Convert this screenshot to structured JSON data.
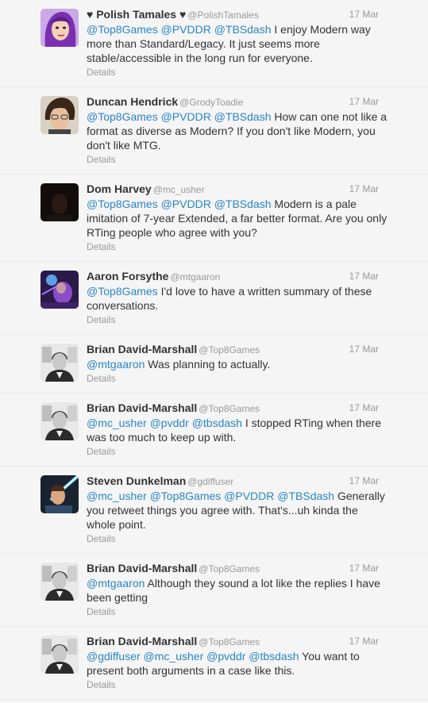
{
  "tweets": [
    {
      "name": "♥ Polish Tamales ♥",
      "handle": "@PolishTamales",
      "time": "17 Mar",
      "avatar": "purple-hair-avatar",
      "segments": [
        {
          "t": "@Top8Games",
          "m": true
        },
        {
          "t": " "
        },
        {
          "t": "@PVDDR",
          "m": true
        },
        {
          "t": " "
        },
        {
          "t": "@TBSdash",
          "m": true
        },
        {
          "t": " I enjoy Modern way more than Standard/Legacy. It just seems more stable/accessible in the long run for everyone."
        }
      ],
      "details": "Details"
    },
    {
      "name": "Duncan Hendrick",
      "handle": "@GrodyToadie",
      "time": "17 Mar",
      "avatar": "face-photo-avatar",
      "segments": [
        {
          "t": "@Top8Games",
          "m": true
        },
        {
          "t": " "
        },
        {
          "t": "@PVDDR",
          "m": true
        },
        {
          "t": " "
        },
        {
          "t": "@TBSdash",
          "m": true
        },
        {
          "t": " How can one not like a format as diverse as Modern? If you don't like Modern, you don't like MTG."
        }
      ],
      "details": "Details"
    },
    {
      "name": "Dom Harvey",
      "handle": "@mc_usher",
      "time": "17 Mar",
      "avatar": "dark-avatar",
      "segments": [
        {
          "t": "@Top8Games",
          "m": true
        },
        {
          "t": " "
        },
        {
          "t": "@PVDDR",
          "m": true
        },
        {
          "t": " "
        },
        {
          "t": "@TBSdash",
          "m": true
        },
        {
          "t": " Modern is a pale imitation of 7-year Extended, a far better format. Are you only RTing people who agree with you?"
        }
      ],
      "details": "Details"
    },
    {
      "name": "Aaron Forsythe",
      "handle": "@mtgaaron",
      "time": "17 Mar",
      "avatar": "purple-scene-avatar",
      "segments": [
        {
          "t": "@Top8Games",
          "m": true
        },
        {
          "t": " I'd love to have a written summary of these conversations."
        }
      ],
      "details": "Details"
    },
    {
      "name": "Brian David-Marshall",
      "handle": "@Top8Games",
      "time": "17 Mar",
      "avatar": "bw-portrait-avatar",
      "segments": [
        {
          "t": "@mtgaaron",
          "m": true
        },
        {
          "t": " Was planning to actually."
        }
      ],
      "details": "Details"
    },
    {
      "name": "Brian David-Marshall",
      "handle": "@Top8Games",
      "time": "17 Mar",
      "avatar": "bw-portrait-avatar",
      "segments": [
        {
          "t": "@mc_usher",
          "m": true
        },
        {
          "t": " "
        },
        {
          "t": "@pvddr",
          "m": true
        },
        {
          "t": " "
        },
        {
          "t": "@tbsdash",
          "m": true
        },
        {
          "t": " I stopped RTing when there was too much to keep up with."
        }
      ],
      "details": "Details"
    },
    {
      "name": "Steven Dunkelman",
      "handle": "@gdiffuser",
      "time": "17 Mar",
      "avatar": "lightsaber-avatar",
      "segments": [
        {
          "t": "@mc_usher",
          "m": true
        },
        {
          "t": " "
        },
        {
          "t": "@Top8Games",
          "m": true
        },
        {
          "t": " "
        },
        {
          "t": "@PVDDR",
          "m": true
        },
        {
          "t": " "
        },
        {
          "t": "@TBSdash",
          "m": true
        },
        {
          "t": " Generally you retweet things you agree with. That's...uh kinda the whole point."
        }
      ],
      "details": "Details"
    },
    {
      "name": "Brian David-Marshall",
      "handle": "@Top8Games",
      "time": "17 Mar",
      "avatar": "bw-portrait-avatar",
      "segments": [
        {
          "t": "@mtgaaron",
          "m": true
        },
        {
          "t": " Although they sound a lot like the replies I have been getting"
        }
      ],
      "details": "Details"
    },
    {
      "name": "Brian David-Marshall",
      "handle": "@Top8Games",
      "time": "17 Mar",
      "avatar": "bw-portrait-avatar",
      "segments": [
        {
          "t": "@gdiffuser",
          "m": true
        },
        {
          "t": " "
        },
        {
          "t": "@mc_usher",
          "m": true
        },
        {
          "t": " "
        },
        {
          "t": "@pvddr",
          "m": true
        },
        {
          "t": " "
        },
        {
          "t": "@tbsdash",
          "m": true
        },
        {
          "t": " You want to present both arguments in a case like this."
        }
      ],
      "details": "Details"
    }
  ],
  "colors": {
    "mention": "#2a85c8",
    "muted": "#999999",
    "background": "#f5f5f5"
  }
}
